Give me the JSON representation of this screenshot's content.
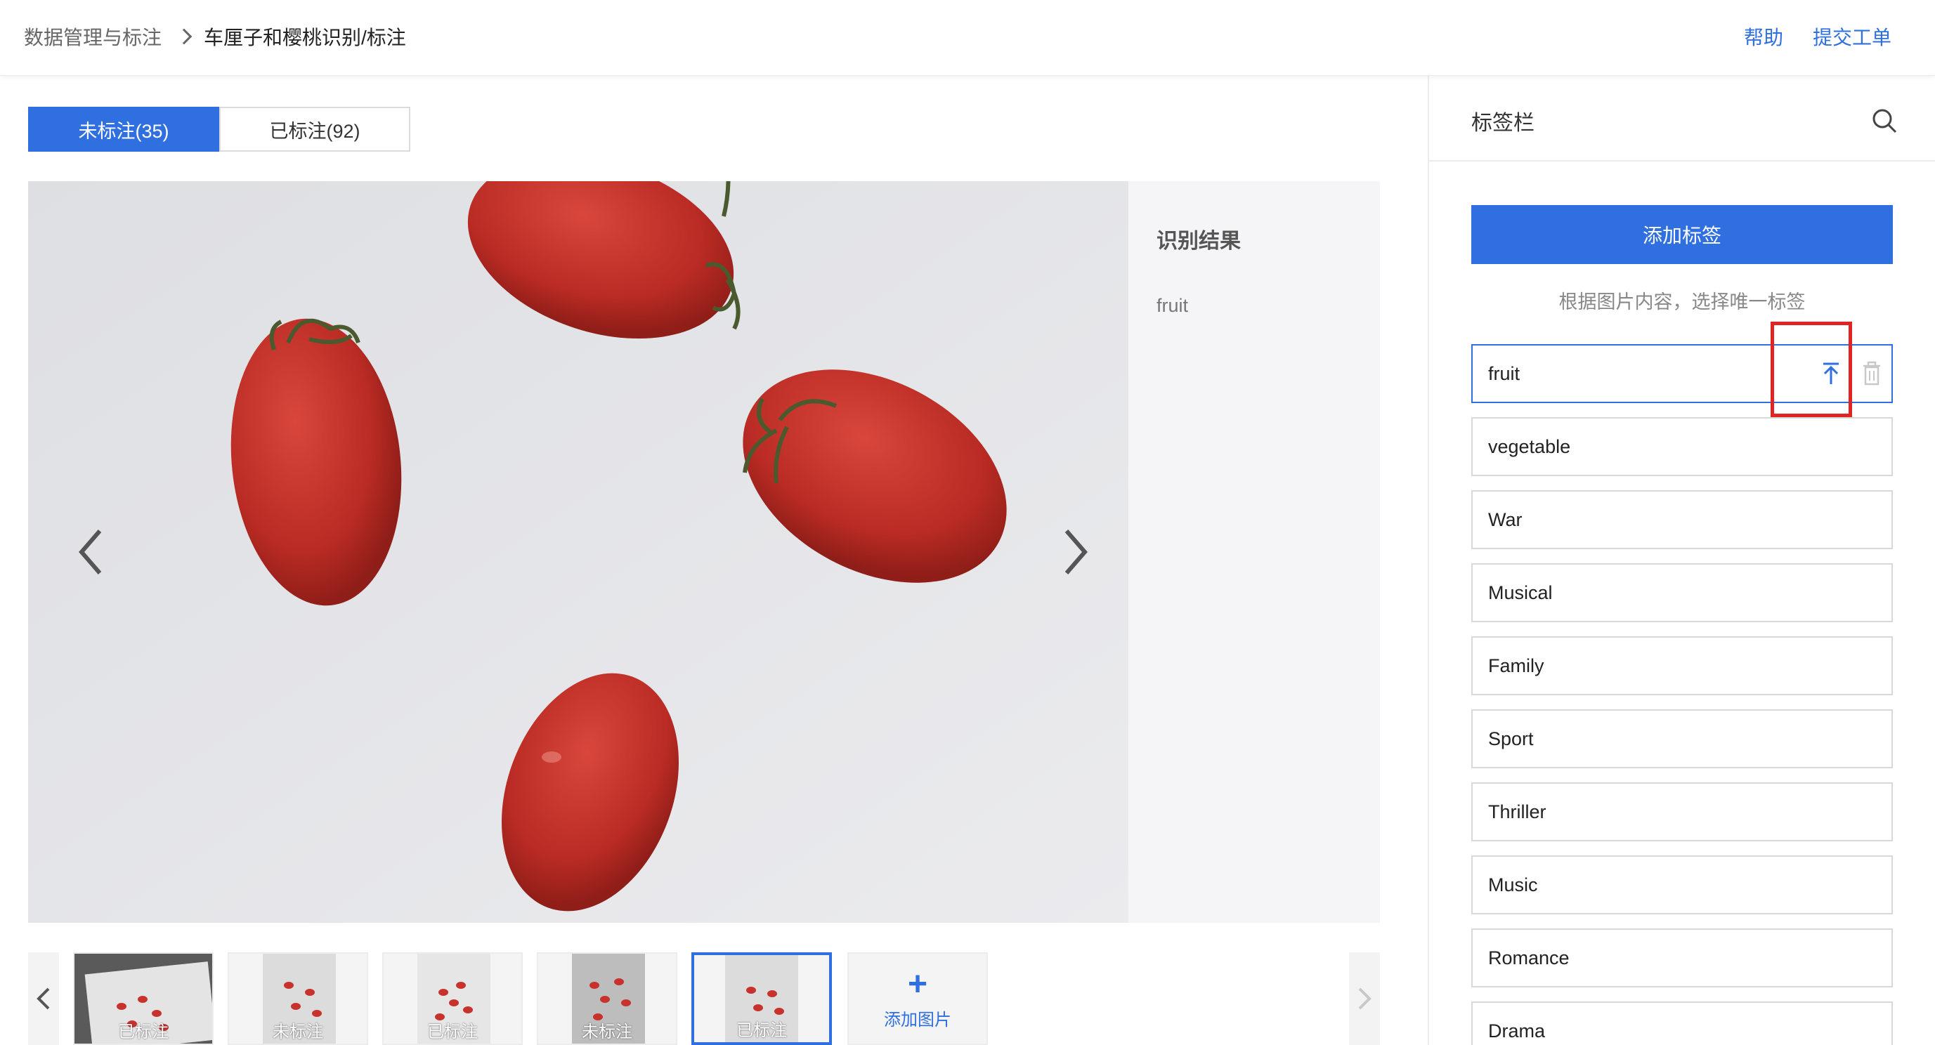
{
  "header": {
    "breadcrumb_root": "数据管理与标注",
    "breadcrumb_current": "车厘子和樱桃识别/标注",
    "help_link": "帮助",
    "ticket_link": "提交工单"
  },
  "tabs": [
    {
      "label": "未标注(35)",
      "active": true
    },
    {
      "label": "已标注(92)",
      "active": false
    }
  ],
  "viewer": {
    "result_title": "识别结果",
    "result_value": "fruit"
  },
  "thumbnails": [
    {
      "label": "已标注",
      "selected": false
    },
    {
      "label": "未标注",
      "selected": false
    },
    {
      "label": "已标注",
      "selected": false
    },
    {
      "label": "未标注",
      "selected": false
    },
    {
      "label": "已标注",
      "selected": true
    }
  ],
  "add_image_label": "添加图片",
  "sidebar": {
    "title": "标签栏",
    "add_tag_button": "添加标签",
    "hint": "根据图片内容，选择唯一标签",
    "tags": [
      {
        "label": "fruit",
        "selected": true
      },
      {
        "label": "vegetable",
        "selected": false
      },
      {
        "label": "War",
        "selected": false
      },
      {
        "label": "Musical",
        "selected": false
      },
      {
        "label": "Family",
        "selected": false
      },
      {
        "label": "Sport",
        "selected": false
      },
      {
        "label": "Thriller",
        "selected": false
      },
      {
        "label": "Music",
        "selected": false
      },
      {
        "label": "Romance",
        "selected": false
      },
      {
        "label": "Drama",
        "selected": false
      }
    ]
  },
  "colors": {
    "primary": "#2f6fdf",
    "highlight": "#e02424",
    "tomato": "#c8322c"
  }
}
